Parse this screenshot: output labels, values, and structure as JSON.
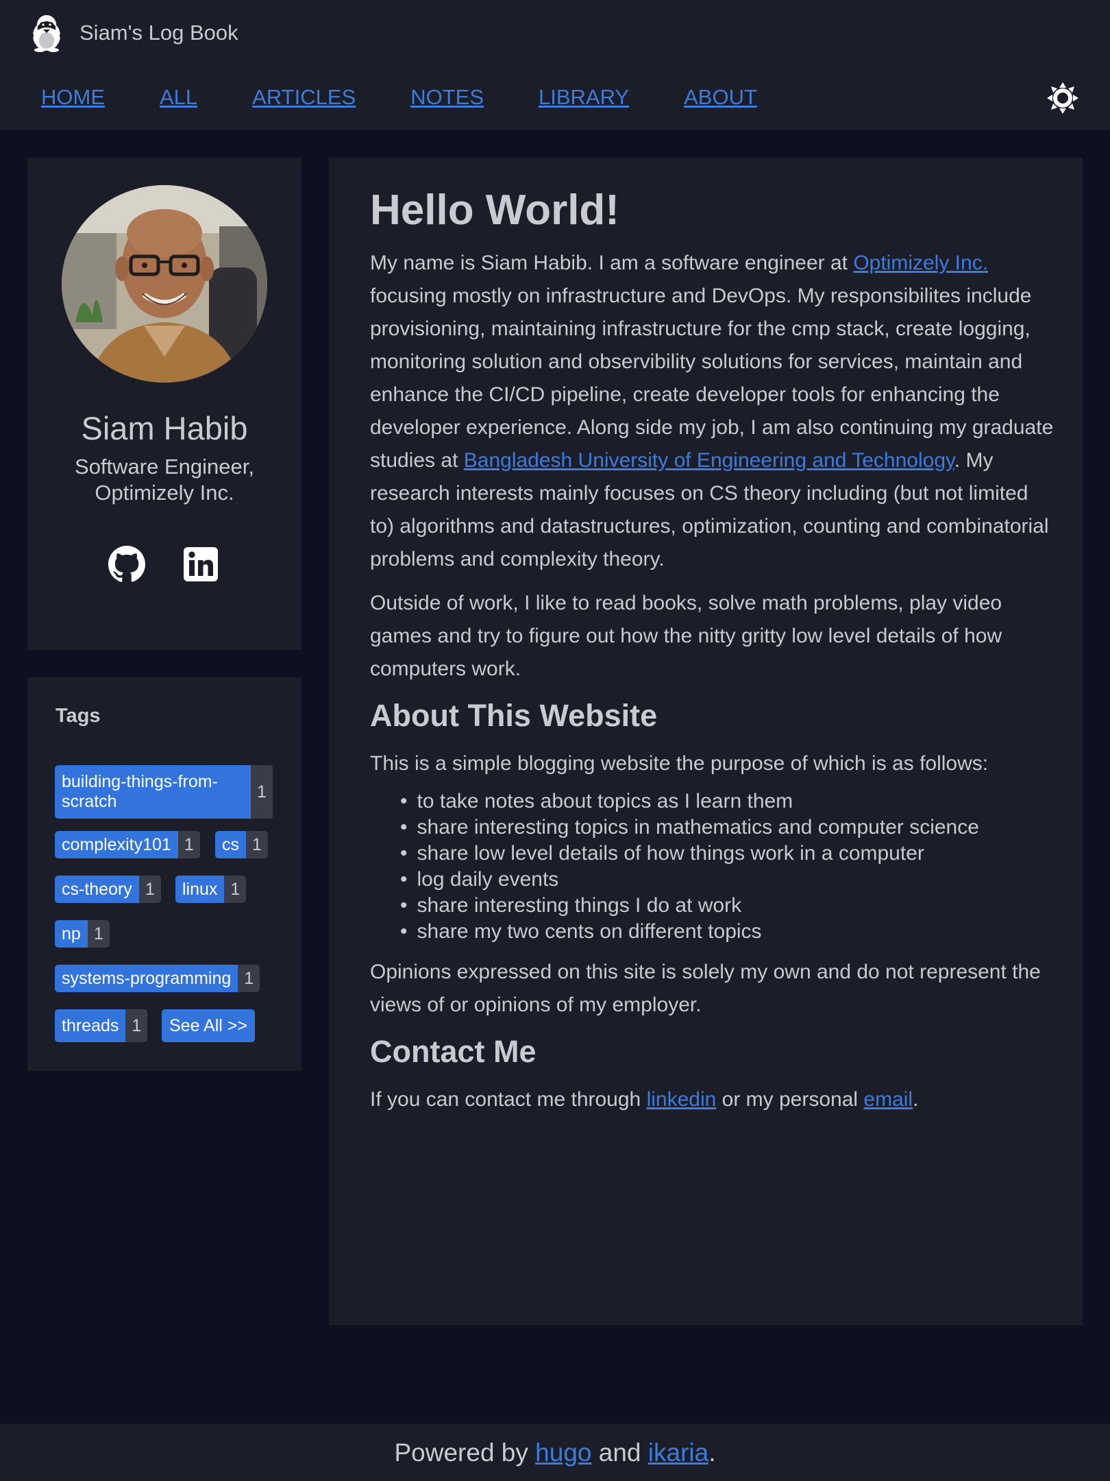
{
  "site": {
    "title": "Siam's Log Book",
    "logo_icon": "penguin-icon"
  },
  "nav": {
    "items": [
      {
        "label": "HOME"
      },
      {
        "label": "ALL"
      },
      {
        "label": "ARTICLES"
      },
      {
        "label": "NOTES"
      },
      {
        "label": "LIBRARY"
      },
      {
        "label": "ABOUT"
      }
    ],
    "theme_toggle_icon": "sun-icon"
  },
  "profile": {
    "name": "Siam Habib",
    "role": "Software Engineer, Optimizely Inc.",
    "socials": [
      {
        "icon": "github-icon"
      },
      {
        "icon": "linkedin-icon"
      }
    ]
  },
  "tags": {
    "title": "Tags",
    "items": [
      {
        "name": "building-things-from-scratch",
        "count": "1"
      },
      {
        "name": "complexity101",
        "count": "1"
      },
      {
        "name": "cs",
        "count": "1"
      },
      {
        "name": "cs-theory",
        "count": "1"
      },
      {
        "name": "linux",
        "count": "1"
      },
      {
        "name": "np",
        "count": "1"
      },
      {
        "name": "systems-programming",
        "count": "1"
      },
      {
        "name": "threads",
        "count": "1"
      }
    ],
    "see_all_label": "See All >>"
  },
  "main": {
    "title": "Hello World!",
    "intro": {
      "text1": "My name is Siam Habib. I am a software engineer at ",
      "link1": "Optimizely Inc.",
      "text2": " focusing mostly on infrastructure and DevOps. My responsibilites include provisioning, maintaining infrastructure for the cmp stack, create logging, monitoring solution and observibility solutions for services, maintain and enhance the CI/CD pipeline, create developer tools for enhancing the developer experience. Along side my job, I am also continuing my graduate studies at ",
      "link2": "Bangladesh University of Engineering and Technology",
      "text3": ". My research interests mainly focuses on CS theory including (but not limited to) algorithms and datastructures, optimization, counting and combinatorial problems and complexity theory."
    },
    "outside_work": "Outside of work, I like to read books, solve math problems, play video games and try to figure out how the nitty gritty low level details of how computers work.",
    "about_title": "About This Website",
    "about_intro": "This is a simple blogging website the purpose of which is as follows:",
    "purposes": [
      "to take notes about topics as I learn them",
      "share interesting topics in mathematics and computer science",
      "share low level details of how things work in a computer",
      "log daily events",
      "share interesting things I do at work",
      "share my two cents on different topics"
    ],
    "opinions": "Opinions expressed on this site is solely my own and do not represent the views of or opinions of my employer.",
    "contact_title": "Contact Me",
    "contact": {
      "text1": "If you can contact me through ",
      "link1": "linkedin",
      "text2": " or my personal ",
      "link2": "email",
      "text3": "."
    }
  },
  "footer": {
    "text1": "Powered by ",
    "link1": "hugo",
    "text2": " and ",
    "link2": "ikaria",
    "text3": "."
  },
  "colors": {
    "background": "#0d1020",
    "surface": "#1b1e29",
    "link": "#3d7cdd",
    "tag": "#3273dc",
    "text": "#c8cad0"
  }
}
